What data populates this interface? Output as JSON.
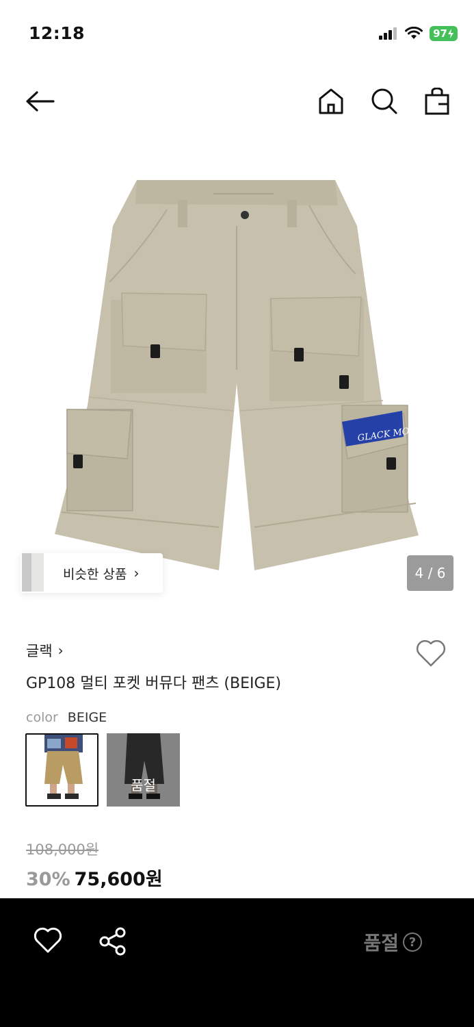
{
  "status_bar": {
    "time": "12:18",
    "battery": "97"
  },
  "gallery": {
    "print_text": "GLACK MOT",
    "similar_label": "비슷한 상품",
    "page_indicator": "4 / 6"
  },
  "product": {
    "brand": "글랙",
    "name": "GP108 멀티 포켓 버뮤다 팬츠 (BEIGE)",
    "color_label": "color",
    "color_value": "BEIGE",
    "swatches": [
      {
        "color": "beige",
        "soldout": ""
      },
      {
        "color": "charcoal",
        "soldout": "품절"
      }
    ],
    "original_price": "108,000원",
    "discount": "30%",
    "price": "75,600원"
  },
  "bottom_bar": {
    "soldout_label": "품절",
    "help_icon": "?"
  },
  "colors": {
    "fabric": "#c7c0ac",
    "fabric_shade": "#b5ae99",
    "print_blue": "#2540a6",
    "battery_green": "#43c05a",
    "bottom_bar": "#000000"
  }
}
